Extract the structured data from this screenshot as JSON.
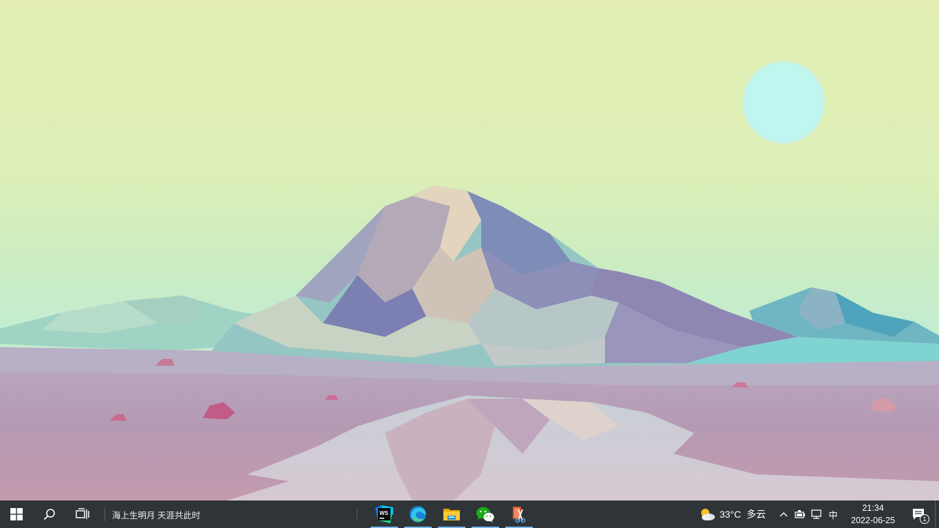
{
  "colors": {
    "taskbar_bg": "#2f3437",
    "active_underline": "#76b9ed",
    "sky": "#dfeeb5"
  },
  "taskbar": {
    "start_icon": "windows-logo-icon",
    "search_icon": "search-icon",
    "taskview_icon": "task-view-icon",
    "motto": "海上生明月 天涯共此时",
    "apps": [
      {
        "name": "WebStorm",
        "icon": "webstorm-icon",
        "badge": "WS",
        "running": true
      },
      {
        "name": "Microsoft Edge",
        "icon": "edge-icon",
        "running": true
      },
      {
        "name": "File Explorer",
        "icon": "file-explorer-icon",
        "running": true
      },
      {
        "name": "WeChat",
        "icon": "wechat-icon",
        "running": true
      },
      {
        "name": "Snipping Tool",
        "icon": "snipping-tool-icon",
        "running": true
      }
    ]
  },
  "tray": {
    "weather_icon": "partly-cloudy-icon",
    "weather_temp": "33°C",
    "weather_desc": "多云",
    "ime": "中",
    "time": "21:34",
    "date": "2022-06-25",
    "notification_count": "1"
  }
}
